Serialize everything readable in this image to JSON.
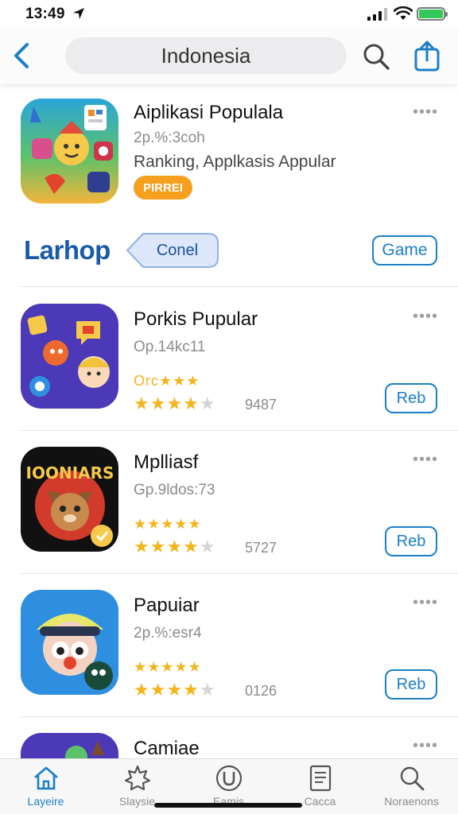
{
  "status_bar": {
    "time": "13:49"
  },
  "nav": {
    "search_text": "Indonesia"
  },
  "featured": {
    "title": "Aiplikasi Populala",
    "subtitle": "2p.%:3coh",
    "description": "Ranking, Applkasis Appular",
    "tag": "PIRREI",
    "more": "••••"
  },
  "banner": {
    "logo": "Larhop",
    "pill_label": "Conel",
    "button": "Game"
  },
  "apps": [
    {
      "title": "Porkis Pupular",
      "subtitle": "Op.14kc11",
      "stars_top": "Orc★★★",
      "rating_count": "9487",
      "button": "Reb",
      "more": "••••"
    },
    {
      "title": "Mplliasf",
      "subtitle": "Gp.9ldos:73",
      "stars_top": "★★★★★",
      "rating_count": "5727",
      "button": "Reb",
      "more": "••••"
    },
    {
      "title": "Papuiar",
      "subtitle": "2p.%:esr4",
      "stars_top": "★★★★★",
      "rating_count": "0126",
      "button": "Reb",
      "more": "••••"
    },
    {
      "title": "Camiae",
      "more": "••••"
    }
  ],
  "icon_art": {
    "tooniars_text": "IOONIARS"
  },
  "tabs": [
    {
      "label": "Layeire",
      "icon": "home-icon",
      "active": true
    },
    {
      "label": "Slaysie",
      "icon": "puzzle-icon",
      "active": false
    },
    {
      "label": "Eamis",
      "icon": "circle-u-icon",
      "active": false
    },
    {
      "label": "Cacca",
      "icon": "document-icon",
      "active": false
    },
    {
      "label": "Noraenons",
      "icon": "search-icon",
      "active": false
    }
  ],
  "colors": {
    "accent": "#1b7fc4",
    "star": "#f3b51c",
    "tag": "#f5a01e",
    "battery": "#34c759"
  }
}
